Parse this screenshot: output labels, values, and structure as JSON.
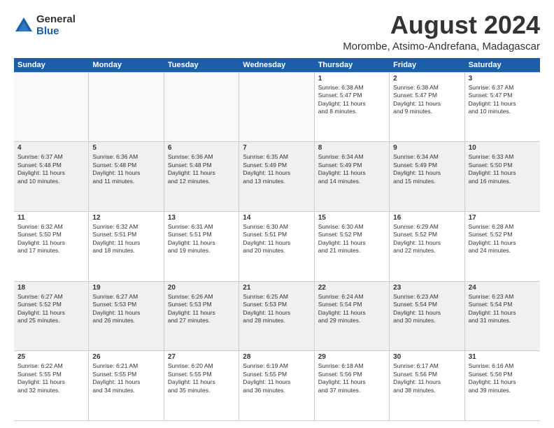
{
  "logo": {
    "general": "General",
    "blue": "Blue"
  },
  "title": "August 2024",
  "location": "Morombe, Atsimo-Andrefana, Madagascar",
  "header": {
    "days": [
      "Sunday",
      "Monday",
      "Tuesday",
      "Wednesday",
      "Thursday",
      "Friday",
      "Saturday"
    ]
  },
  "weeks": [
    [
      {
        "day": "",
        "info": ""
      },
      {
        "day": "",
        "info": ""
      },
      {
        "day": "",
        "info": ""
      },
      {
        "day": "",
        "info": ""
      },
      {
        "day": "1",
        "info": "Sunrise: 6:38 AM\nSunset: 5:47 PM\nDaylight: 11 hours\nand 8 minutes."
      },
      {
        "day": "2",
        "info": "Sunrise: 6:38 AM\nSunset: 5:47 PM\nDaylight: 11 hours\nand 9 minutes."
      },
      {
        "day": "3",
        "info": "Sunrise: 6:37 AM\nSunset: 5:47 PM\nDaylight: 11 hours\nand 10 minutes."
      }
    ],
    [
      {
        "day": "4",
        "info": "Sunrise: 6:37 AM\nSunset: 5:48 PM\nDaylight: 11 hours\nand 10 minutes."
      },
      {
        "day": "5",
        "info": "Sunrise: 6:36 AM\nSunset: 5:48 PM\nDaylight: 11 hours\nand 11 minutes."
      },
      {
        "day": "6",
        "info": "Sunrise: 6:36 AM\nSunset: 5:48 PM\nDaylight: 11 hours\nand 12 minutes."
      },
      {
        "day": "7",
        "info": "Sunrise: 6:35 AM\nSunset: 5:49 PM\nDaylight: 11 hours\nand 13 minutes."
      },
      {
        "day": "8",
        "info": "Sunrise: 6:34 AM\nSunset: 5:49 PM\nDaylight: 11 hours\nand 14 minutes."
      },
      {
        "day": "9",
        "info": "Sunrise: 6:34 AM\nSunset: 5:49 PM\nDaylight: 11 hours\nand 15 minutes."
      },
      {
        "day": "10",
        "info": "Sunrise: 6:33 AM\nSunset: 5:50 PM\nDaylight: 11 hours\nand 16 minutes."
      }
    ],
    [
      {
        "day": "11",
        "info": "Sunrise: 6:32 AM\nSunset: 5:50 PM\nDaylight: 11 hours\nand 17 minutes."
      },
      {
        "day": "12",
        "info": "Sunrise: 6:32 AM\nSunset: 5:51 PM\nDaylight: 11 hours\nand 18 minutes."
      },
      {
        "day": "13",
        "info": "Sunrise: 6:31 AM\nSunset: 5:51 PM\nDaylight: 11 hours\nand 19 minutes."
      },
      {
        "day": "14",
        "info": "Sunrise: 6:30 AM\nSunset: 5:51 PM\nDaylight: 11 hours\nand 20 minutes."
      },
      {
        "day": "15",
        "info": "Sunrise: 6:30 AM\nSunset: 5:52 PM\nDaylight: 11 hours\nand 21 minutes."
      },
      {
        "day": "16",
        "info": "Sunrise: 6:29 AM\nSunset: 5:52 PM\nDaylight: 11 hours\nand 22 minutes."
      },
      {
        "day": "17",
        "info": "Sunrise: 6:28 AM\nSunset: 5:52 PM\nDaylight: 11 hours\nand 24 minutes."
      }
    ],
    [
      {
        "day": "18",
        "info": "Sunrise: 6:27 AM\nSunset: 5:52 PM\nDaylight: 11 hours\nand 25 minutes."
      },
      {
        "day": "19",
        "info": "Sunrise: 6:27 AM\nSunset: 5:53 PM\nDaylight: 11 hours\nand 26 minutes."
      },
      {
        "day": "20",
        "info": "Sunrise: 6:26 AM\nSunset: 5:53 PM\nDaylight: 11 hours\nand 27 minutes."
      },
      {
        "day": "21",
        "info": "Sunrise: 6:25 AM\nSunset: 5:53 PM\nDaylight: 11 hours\nand 28 minutes."
      },
      {
        "day": "22",
        "info": "Sunrise: 6:24 AM\nSunset: 5:54 PM\nDaylight: 11 hours\nand 29 minutes."
      },
      {
        "day": "23",
        "info": "Sunrise: 6:23 AM\nSunset: 5:54 PM\nDaylight: 11 hours\nand 30 minutes."
      },
      {
        "day": "24",
        "info": "Sunrise: 6:23 AM\nSunset: 5:54 PM\nDaylight: 11 hours\nand 31 minutes."
      }
    ],
    [
      {
        "day": "25",
        "info": "Sunrise: 6:22 AM\nSunset: 5:55 PM\nDaylight: 11 hours\nand 32 minutes."
      },
      {
        "day": "26",
        "info": "Sunrise: 6:21 AM\nSunset: 5:55 PM\nDaylight: 11 hours\nand 34 minutes."
      },
      {
        "day": "27",
        "info": "Sunrise: 6:20 AM\nSunset: 5:55 PM\nDaylight: 11 hours\nand 35 minutes."
      },
      {
        "day": "28",
        "info": "Sunrise: 6:19 AM\nSunset: 5:55 PM\nDaylight: 11 hours\nand 36 minutes."
      },
      {
        "day": "29",
        "info": "Sunrise: 6:18 AM\nSunset: 5:56 PM\nDaylight: 11 hours\nand 37 minutes."
      },
      {
        "day": "30",
        "info": "Sunrise: 6:17 AM\nSunset: 5:56 PM\nDaylight: 11 hours\nand 38 minutes."
      },
      {
        "day": "31",
        "info": "Sunrise: 6:16 AM\nSunset: 5:56 PM\nDaylight: 11 hours\nand 39 minutes."
      }
    ]
  ]
}
